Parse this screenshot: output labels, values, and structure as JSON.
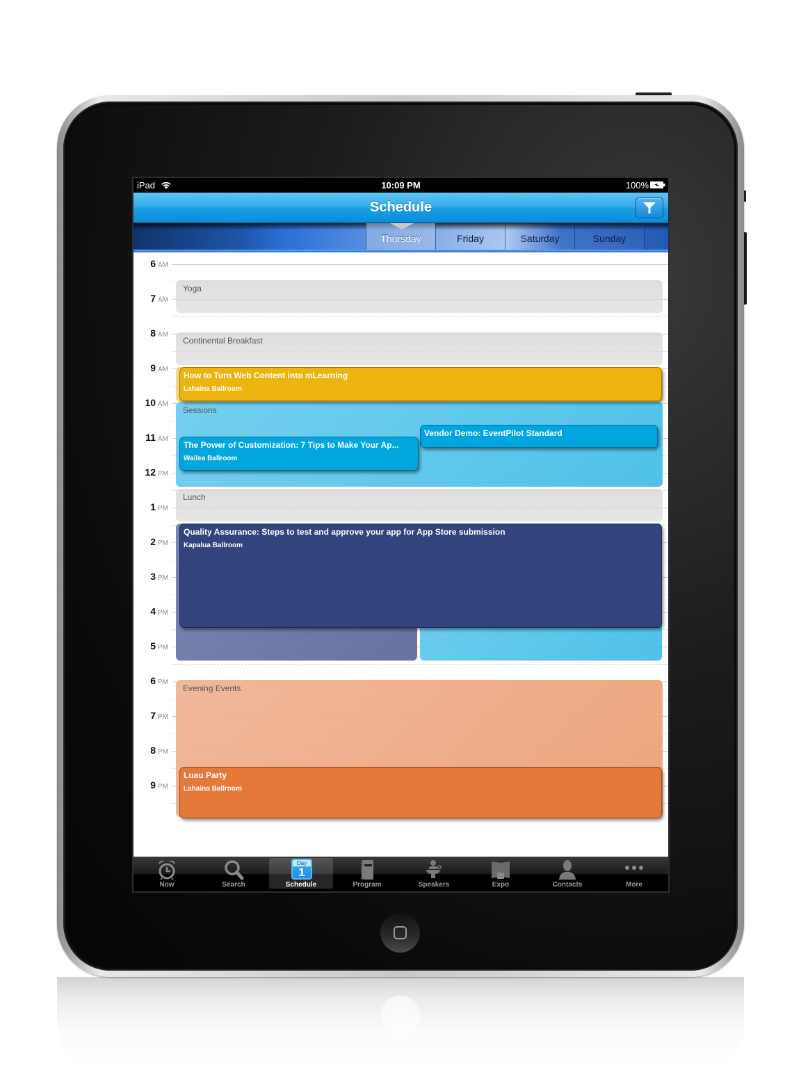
{
  "device": {
    "name": "iPad"
  },
  "status_bar": {
    "carrier": "iPad",
    "time": "10:09 PM",
    "battery": "100%"
  },
  "nav_bar": {
    "title": "Schedule",
    "filter_icon": "funnel-icon"
  },
  "days": [
    {
      "label": "Thursday",
      "selected": true
    },
    {
      "label": "Friday",
      "selected": false
    },
    {
      "label": "Saturday",
      "selected": false
    },
    {
      "label": "Sunday",
      "selected": false
    }
  ],
  "hours": [
    {
      "h": "6",
      "ampm": "AM"
    },
    {
      "h": "7",
      "ampm": "AM"
    },
    {
      "h": "8",
      "ampm": "AM"
    },
    {
      "h": "9",
      "ampm": "AM"
    },
    {
      "h": "10",
      "ampm": "AM"
    },
    {
      "h": "11",
      "ampm": "AM"
    },
    {
      "h": "12",
      "ampm": "PM"
    },
    {
      "h": "1",
      "ampm": "PM"
    },
    {
      "h": "2",
      "ampm": "PM"
    },
    {
      "h": "3",
      "ampm": "PM"
    },
    {
      "h": "4",
      "ampm": "PM"
    },
    {
      "h": "5",
      "ampm": "PM"
    },
    {
      "h": "6",
      "ampm": "PM"
    },
    {
      "h": "7",
      "ampm": "PM"
    },
    {
      "h": "8",
      "ampm": "PM"
    },
    {
      "h": "9",
      "ampm": "PM"
    }
  ],
  "blocks": {
    "yoga": "Yoga",
    "breakfast": "Continental Breakfast",
    "sessions": "Sessions",
    "lunch": "Lunch",
    "evening": "Evening Events"
  },
  "events": {
    "mlearning": {
      "title": "How to Turn Web Content into mLearning",
      "room": "Lahaina Ballroom",
      "color": "#edb30f"
    },
    "customization": {
      "title": "The Power of Customization: 7 Tips to Make Your Ap...",
      "room": "Wailea Ballroom",
      "color": "#02a6df"
    },
    "vendor_demo": {
      "title": "Vendor Demo: EventPilot Standard",
      "room": "",
      "color": "#02a6df"
    },
    "qa": {
      "title": "Quality Assurance: Steps to test and approve your app for App Store submission",
      "room": "Kapalua Ballroom",
      "color": "#33437c"
    },
    "luau": {
      "title": "Luau Party",
      "room": "Lahaina Ballroom",
      "color": "#e5793a"
    }
  },
  "tab_bar": [
    {
      "label": "Now",
      "icon": "alarm-clock-icon"
    },
    {
      "label": "Search",
      "icon": "magnifier-icon"
    },
    {
      "label": "Schedule",
      "icon": "calendar-day-icon",
      "active": true,
      "icon_top": "Day",
      "icon_num": "1"
    },
    {
      "label": "Program",
      "icon": "notebook-icon"
    },
    {
      "label": "Speakers",
      "icon": "podium-speaker-icon"
    },
    {
      "label": "Expo",
      "icon": "booth-icon"
    },
    {
      "label": "Contacts",
      "icon": "person-icon"
    },
    {
      "label": "More",
      "icon": "more-dots-icon"
    }
  ]
}
